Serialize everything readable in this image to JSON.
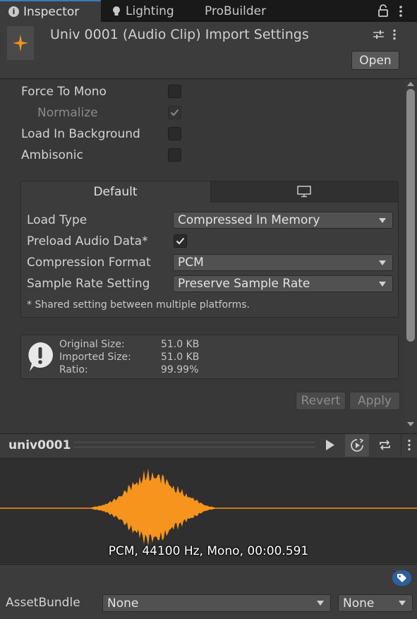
{
  "tabs": {
    "inspector": "Inspector",
    "lighting": "Lighting",
    "probuilder": "ProBuilder"
  },
  "header": {
    "title": "Univ 0001 (Audio Clip) Import Settings",
    "open_label": "Open"
  },
  "settings": {
    "force_to_mono": {
      "label": "Force To Mono",
      "checked": false
    },
    "normalize": {
      "label": "Normalize",
      "checked": true,
      "disabled": true
    },
    "load_in_background": {
      "label": "Load In Background",
      "checked": false
    },
    "ambisonic": {
      "label": "Ambisonic",
      "checked": false
    }
  },
  "platform": {
    "default_tab": "Default",
    "standalone_icon": "monitor-icon",
    "load_type": {
      "label": "Load Type",
      "value": "Compressed In Memory"
    },
    "preload_audio_data": {
      "label": "Preload Audio Data*",
      "checked": true
    },
    "compression_format": {
      "label": "Compression Format",
      "value": "PCM"
    },
    "sample_rate_setting": {
      "label": "Sample Rate Setting",
      "value": "Preserve Sample Rate"
    },
    "note": "* Shared setting between multiple platforms."
  },
  "info": {
    "original_size_label": "Original Size:",
    "original_size_value": "51.0 KB",
    "imported_size_label": "Imported Size:",
    "imported_size_value": "51.0 KB",
    "ratio_label": "Ratio:",
    "ratio_value": "99.99%"
  },
  "actions": {
    "revert": "Revert",
    "apply": "Apply"
  },
  "preview": {
    "name": "univ0001",
    "info": "PCM, 44100 Hz, Mono, 00:00.591",
    "waveform_color": "#f7941d"
  },
  "asset_bundle": {
    "label": "AssetBundle",
    "name_value": "None",
    "variant_value": "None"
  },
  "colors": {
    "accent": "#3a79bb",
    "waveform": "#f7941d"
  }
}
